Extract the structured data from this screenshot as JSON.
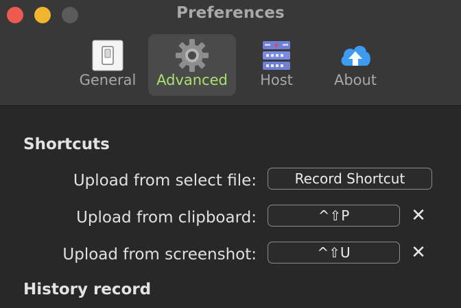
{
  "window": {
    "title": "Preferences"
  },
  "tabs": [
    {
      "label": "General",
      "icon": "switch-icon"
    },
    {
      "label": "Advanced",
      "icon": "gear-icon",
      "active": true
    },
    {
      "label": "Host",
      "icon": "server-icon"
    },
    {
      "label": "About",
      "icon": "cloud-upload-icon"
    }
  ],
  "shortcuts": {
    "heading": "Shortcuts",
    "rows": [
      {
        "label": "Upload from select file:",
        "button": "Record Shortcut"
      },
      {
        "label": "Upload from clipboard:",
        "button": "^⇧P",
        "clear": "✕"
      },
      {
        "label": "Upload from screenshot:",
        "button": "^⇧U",
        "clear": "✕"
      }
    ]
  },
  "history": {
    "heading": "History record"
  },
  "colors": {
    "accent_active_tab": "#a9e36e",
    "close": "#ee5a50",
    "minimize": "#f0b52f",
    "maximize": "#5a5a5a"
  }
}
